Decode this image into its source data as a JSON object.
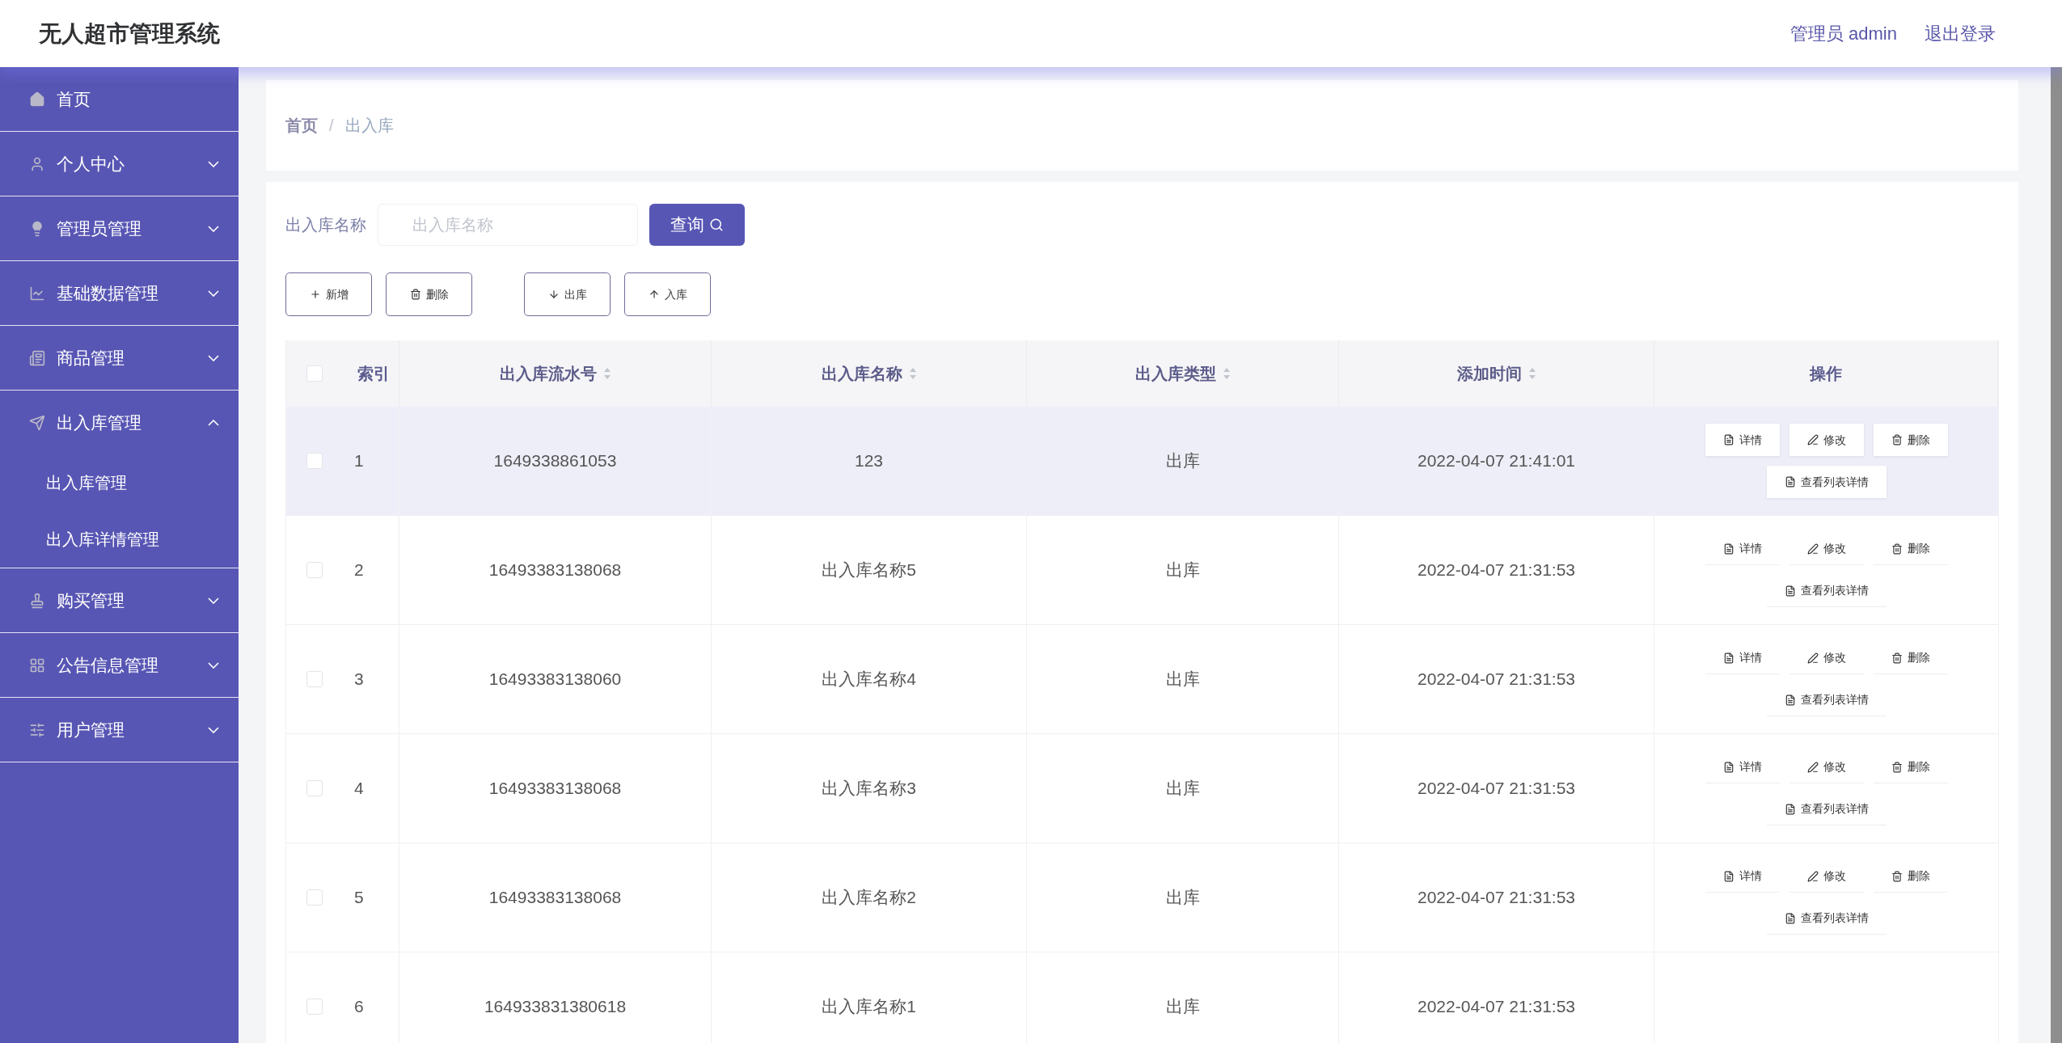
{
  "header": {
    "title": "无人超市管理系统",
    "user": "管理员 admin",
    "logout": "退出登录"
  },
  "sidebar": {
    "items": [
      {
        "label": "首页"
      },
      {
        "label": "个人中心",
        "expanded": false
      },
      {
        "label": "管理员管理",
        "expanded": false
      },
      {
        "label": "基础数据管理",
        "expanded": false
      },
      {
        "label": "商品管理",
        "expanded": false
      },
      {
        "label": "出入库管理",
        "expanded": true,
        "children": [
          {
            "label": "出入库管理"
          },
          {
            "label": "出入库详情管理"
          }
        ]
      },
      {
        "label": "购买管理",
        "expanded": false
      },
      {
        "label": "公告信息管理",
        "expanded": false
      },
      {
        "label": "用户管理",
        "expanded": false
      }
    ]
  },
  "breadcrumb": {
    "items": [
      "首页",
      "出入库"
    ],
    "separator": "/"
  },
  "search": {
    "label": "出入库名称",
    "placeholder": "出入库名称",
    "button": "查询"
  },
  "actions": [
    {
      "label": "新增",
      "kind": "add"
    },
    {
      "label": "删除",
      "kind": "delete"
    },
    {
      "label": "出库",
      "kind": "out"
    },
    {
      "label": "入库",
      "kind": "in"
    }
  ],
  "table": {
    "select_all": {
      "checked": false
    },
    "columns": [
      {
        "label": "索引"
      },
      {
        "label": "出入库流水号",
        "sortable": true
      },
      {
        "label": "出入库名称",
        "sortable": true
      },
      {
        "label": "出入库类型",
        "sortable": true
      },
      {
        "label": "添加时间",
        "sortable": true
      },
      {
        "label": "操作"
      }
    ],
    "rows": [
      {
        "checked": false,
        "highlighted": true,
        "cells": [
          "1",
          "1649338861053",
          "123",
          "出库",
          "2022-04-07 21:41:01"
        ],
        "ops": [
          "详情",
          "修改",
          "删除",
          "查看列表详情"
        ]
      },
      {
        "checked": false,
        "highlighted": false,
        "cells": [
          "2",
          "16493383138068",
          "出入库名称5",
          "出库",
          "2022-04-07 21:31:53"
        ],
        "ops": [
          "详情",
          "修改",
          "删除",
          "查看列表详情"
        ]
      },
      {
        "checked": false,
        "highlighted": false,
        "cells": [
          "3",
          "16493383138060",
          "出入库名称4",
          "出库",
          "2022-04-07 21:31:53"
        ],
        "ops": [
          "详情",
          "修改",
          "删除",
          "查看列表详情"
        ]
      },
      {
        "checked": false,
        "highlighted": false,
        "cells": [
          "4",
          "16493383138068",
          "出入库名称3",
          "出库",
          "2022-04-07 21:31:53"
        ],
        "ops": [
          "详情",
          "修改",
          "删除",
          "查看列表详情"
        ]
      },
      {
        "checked": false,
        "highlighted": false,
        "cells": [
          "5",
          "16493383138068",
          "出入库名称2",
          "出库",
          "2022-04-07 21:31:53"
        ],
        "ops": [
          "详情",
          "修改",
          "删除",
          "查看列表详情"
        ]
      },
      {
        "checked": false,
        "highlighted": false,
        "cells": [
          "6",
          "164933831380618",
          "出入库名称1",
          "出库",
          "2022-04-07 21:31:53"
        ],
        "ops": []
      }
    ]
  }
}
